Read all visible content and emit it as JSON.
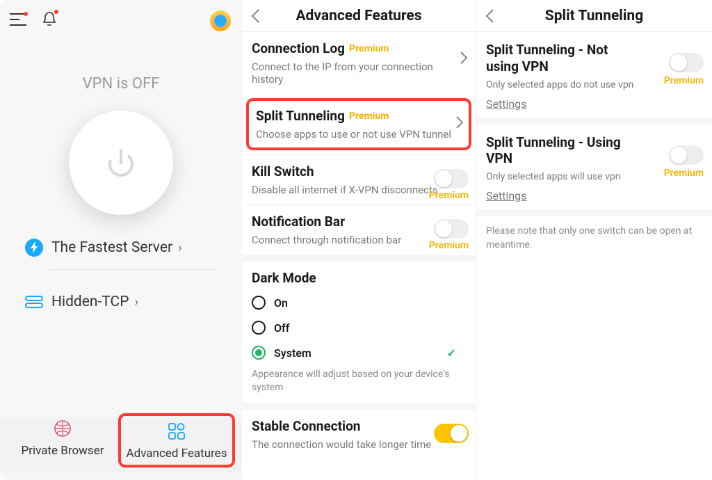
{
  "pane1": {
    "status": "VPN is OFF",
    "server_label": "The Fastest Server",
    "protocol_label": "Hidden-TCP",
    "bottom": {
      "private_browser": "Private Browser",
      "advanced_features": "Advanced Features"
    }
  },
  "pane2": {
    "title": "Advanced Features",
    "items": [
      {
        "title": "Connection Log",
        "badge": "Premium",
        "desc": "Connect to the IP from your connection history"
      },
      {
        "title": "Split Tunneling",
        "badge": "Premium",
        "desc": "Choose apps to use or not use VPN tunnel"
      },
      {
        "title": "Kill Switch",
        "desc": "Disable all internet if X-VPN disconnects",
        "premium_side": "Premium"
      },
      {
        "title": "Notification Bar",
        "desc": "Connect through notification bar",
        "premium_side": "Premium"
      }
    ],
    "darkmode": {
      "title": "Dark Mode",
      "on": "On",
      "off": "Off",
      "system": "System",
      "hint": "Appearance will adjust based on your device's system"
    },
    "stable": {
      "title": "Stable Connection",
      "desc": "The connection would take longer time"
    }
  },
  "pane3": {
    "title": "Split Tunneling",
    "a": {
      "title": "Split Tunneling - Not using VPN",
      "desc": "Only selected apps do not use vpn",
      "settings": "Settings",
      "premium": "Premium"
    },
    "b": {
      "title": "Split Tunneling - Using VPN",
      "desc": "Only selected apps will use vpn",
      "settings": "Settings",
      "premium": "Premium"
    },
    "note": "Please note that only one switch can be open at meantime."
  }
}
